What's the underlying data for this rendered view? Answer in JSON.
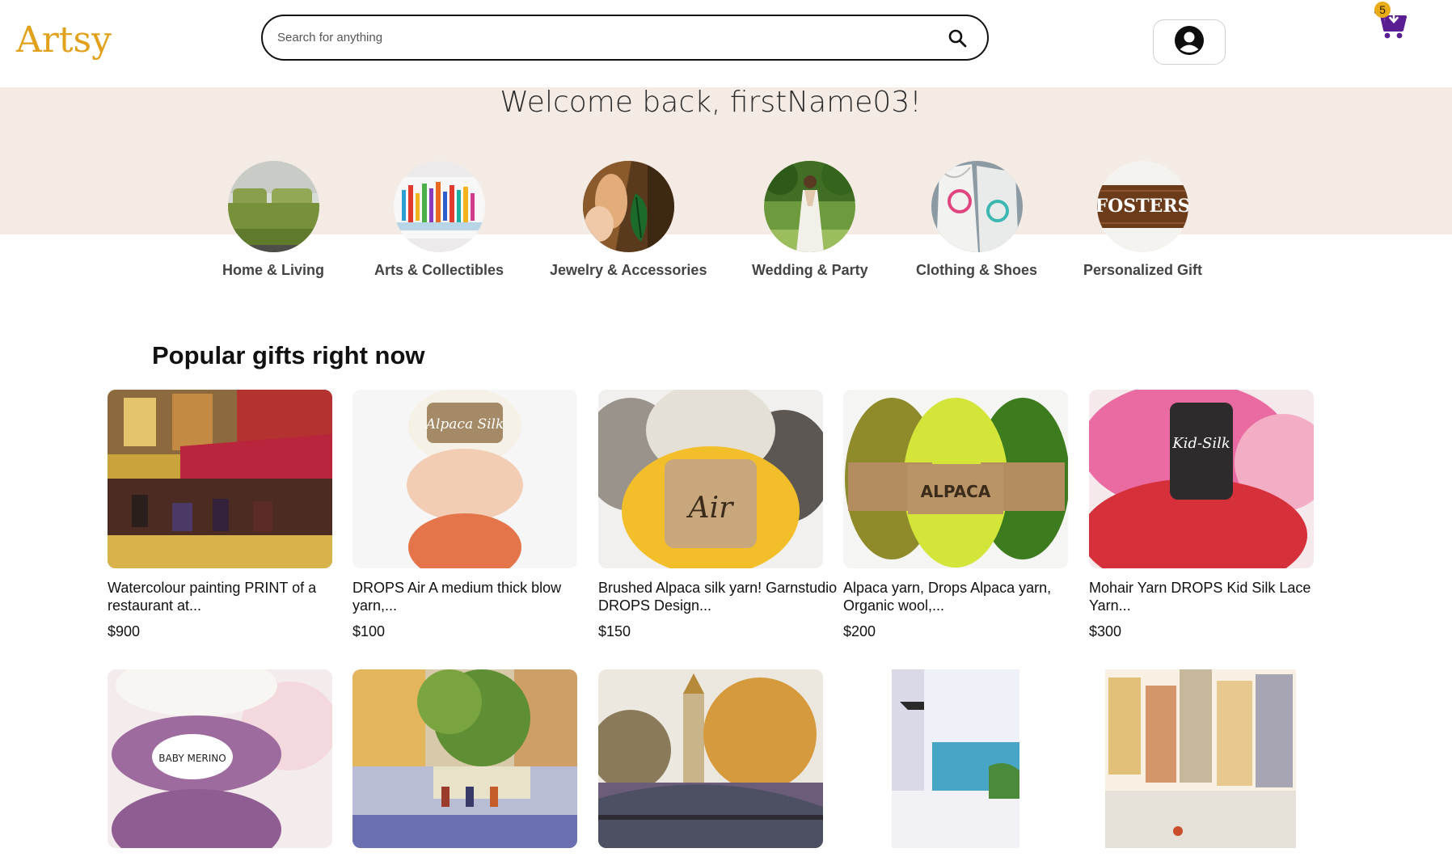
{
  "header": {
    "logo": "Artsy",
    "search_placeholder": "Search for anything",
    "cart_count": "5",
    "search_icon": "search-icon",
    "account_icon": "user-circle-icon",
    "cart_icon": "shopping-cart-icon"
  },
  "hero": {
    "welcome": "Welcome back, firstName03!"
  },
  "categories": [
    {
      "label": "Home & Living"
    },
    {
      "label": "Arts & Collectibles"
    },
    {
      "label": "Jewelry & Accessories"
    },
    {
      "label": "Wedding & Party"
    },
    {
      "label": "Clothing & Shoes"
    },
    {
      "label": "Personalized Gift",
      "image_text": "FOSTERS"
    }
  ],
  "popular": {
    "title": "Popular gifts right now",
    "products": [
      {
        "title": "Watercolour painting PRINT of a restaurant at...",
        "price": "$900"
      },
      {
        "title": "DROPS Air A medium thick blow yarn,...",
        "price": "$100",
        "image_label": "Alpaca Silk"
      },
      {
        "title": "Brushed Alpaca silk yarn! Garnstudio DROPS Design...",
        "price": "$150",
        "image_label": "Air"
      },
      {
        "title": "Alpaca yarn, Drops Alpaca yarn, Organic wool,...",
        "price": "$200",
        "image_label": "ALPACA"
      },
      {
        "title": "Mohair Yarn DROPS Kid Silk Lace Yarn...",
        "price": "$300",
        "image_label": "Kid-Silk"
      }
    ],
    "second_row_labels": [
      "BABY MERINO"
    ]
  },
  "colors": {
    "brand": "#e2a11a",
    "hero_bg": "#f4ebe4",
    "cart": "#5b1e92",
    "badge": "#e9ab16"
  }
}
